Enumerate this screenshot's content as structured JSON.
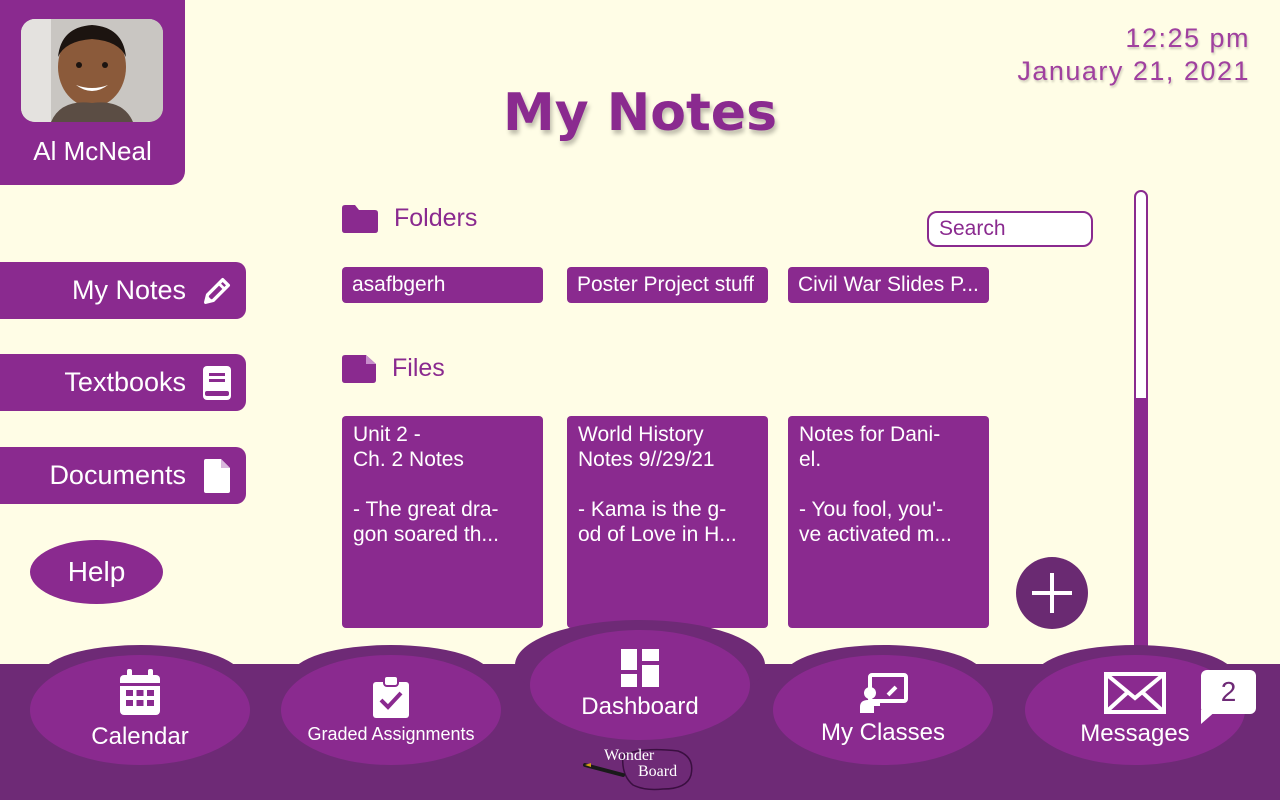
{
  "profile": {
    "name": "Al McNeal",
    "avatar_icon": "student-photo"
  },
  "clock": {
    "time": "12:25 pm",
    "date": "January 21, 2021"
  },
  "page": {
    "title": "My Notes"
  },
  "sidebar": {
    "items": [
      {
        "label": "My Notes",
        "icon": "pencil-icon"
      },
      {
        "label": "Textbooks",
        "icon": "book-icon"
      },
      {
        "label": "Documents",
        "icon": "document-icon"
      }
    ],
    "help_label": "Help"
  },
  "folders": {
    "heading": "Folders",
    "items": [
      "asafbgerh",
      "Poster Project stuff",
      "Civil War Slides P..."
    ]
  },
  "search": {
    "placeholder": "Search"
  },
  "files": {
    "heading": "Files",
    "items": [
      {
        "title_lines": [
          "Unit 2 -",
          "Ch. 2 Notes"
        ],
        "preview_lines": [
          "- The great dra-",
          "gon soared th..."
        ]
      },
      {
        "title_lines": [
          "World History",
          "Notes 9//29/21"
        ],
        "preview_lines": [
          "- Kama is the g-",
          "od of Love in H..."
        ]
      },
      {
        "title_lines": [
          "Notes for Dani-",
          "el."
        ],
        "preview_lines": [
          "- You fool, you'-",
          "ve activated m..."
        ]
      }
    ]
  },
  "bottom_nav": {
    "items": [
      {
        "label": "Calendar",
        "icon": "calendar-icon"
      },
      {
        "label": "Graded Assignments",
        "icon": "clipboard-check-icon"
      },
      {
        "label": "Dashboard",
        "icon": "dashboard-icon"
      },
      {
        "label": "My Classes",
        "icon": "presentation-icon"
      },
      {
        "label": "Messages",
        "icon": "envelope-icon"
      }
    ],
    "messages_badge": "2"
  },
  "logo": {
    "line1": "Wonder",
    "line2": "Board"
  },
  "colors": {
    "primary": "#8a2a8f",
    "dark": "#6e2a76",
    "background": "#fffde6"
  }
}
